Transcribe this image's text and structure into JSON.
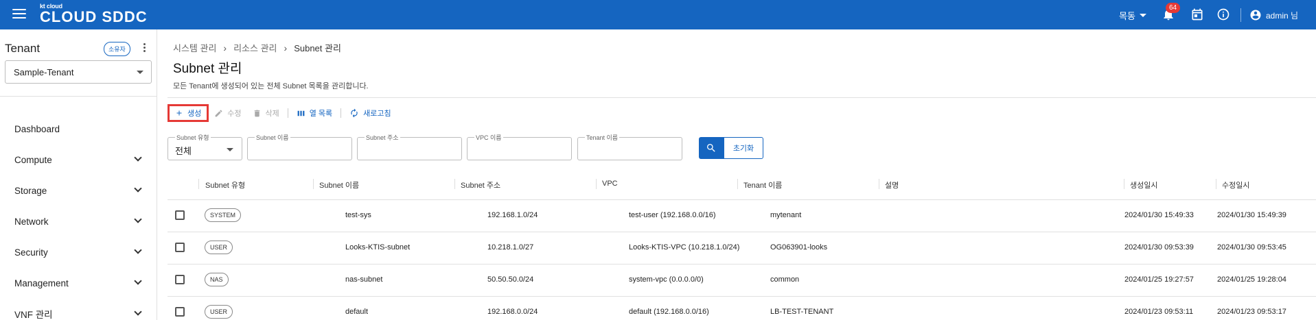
{
  "header": {
    "logo_small": "kt cloud",
    "logo_big": "CLOUD SDDC",
    "region": "목동",
    "notification_count": "64",
    "user": "admin 님"
  },
  "sidebar": {
    "tenant_title": "Tenant",
    "owner_label": "소유자",
    "tenant_value": "Sample-Tenant",
    "items": [
      {
        "label": "Dashboard"
      },
      {
        "label": "Compute"
      },
      {
        "label": "Storage"
      },
      {
        "label": "Network"
      },
      {
        "label": "Security"
      },
      {
        "label": "Management"
      },
      {
        "label": "VNF 관리"
      }
    ]
  },
  "breadcrumb": [
    "시스템 관리",
    "리소스 관리",
    "Subnet 관리"
  ],
  "page": {
    "title": "Subnet 관리",
    "description": "모든 Tenant에 생성되어 있는 전체 Subnet 목록을 관리합니다."
  },
  "toolbar": {
    "create": "생성",
    "edit": "수정",
    "delete": "삭제",
    "columns": "열 목록",
    "refresh": "새로고침"
  },
  "filters": {
    "subnet_type_label": "Subnet 유형",
    "subnet_type_value": "전체",
    "subnet_name_label": "Subnet 이름",
    "subnet_addr_label": "Subnet 주소",
    "vpc_name_label": "VPC 이름",
    "tenant_name_label": "Tenant 이름",
    "reset": "초기화"
  },
  "table": {
    "headers": [
      "Subnet 유형",
      "Subnet 이름",
      "Subnet 주소",
      "VPC",
      "Tenant 이름",
      "설명",
      "생성일시",
      "수정일시"
    ],
    "rows": [
      {
        "type": "SYSTEM",
        "name": "test-sys",
        "address": "192.168.1.0/24",
        "vpc": "test-user (192.168.0.0/16)",
        "tenant": "mytenant",
        "desc": "",
        "created": "2024/01/30 15:49:33",
        "modified": "2024/01/30 15:49:39"
      },
      {
        "type": "USER",
        "name": "Looks-KTIS-subnet",
        "address": "10.218.1.0/27",
        "vpc": "Looks-KTIS-VPC (10.218.1.0/24)",
        "tenant": "OG063901-looks",
        "desc": "",
        "created": "2024/01/30 09:53:39",
        "modified": "2024/01/30 09:53:45"
      },
      {
        "type": "NAS",
        "name": "nas-subnet",
        "address": "50.50.50.0/24",
        "vpc": "system-vpc (0.0.0.0/0)",
        "tenant": "common",
        "desc": "",
        "created": "2024/01/25 19:27:57",
        "modified": "2024/01/25 19:28:04"
      },
      {
        "type": "USER",
        "name": "default",
        "address": "192.168.0.0/24",
        "vpc": "default (192.168.0.0/16)",
        "tenant": "LB-TEST-TENANT",
        "desc": "",
        "created": "2024/01/23 09:53:11",
        "modified": "2024/01/23 09:53:17"
      }
    ]
  },
  "colors": {
    "brand": "#1565c0",
    "highlight": "#e53935"
  }
}
